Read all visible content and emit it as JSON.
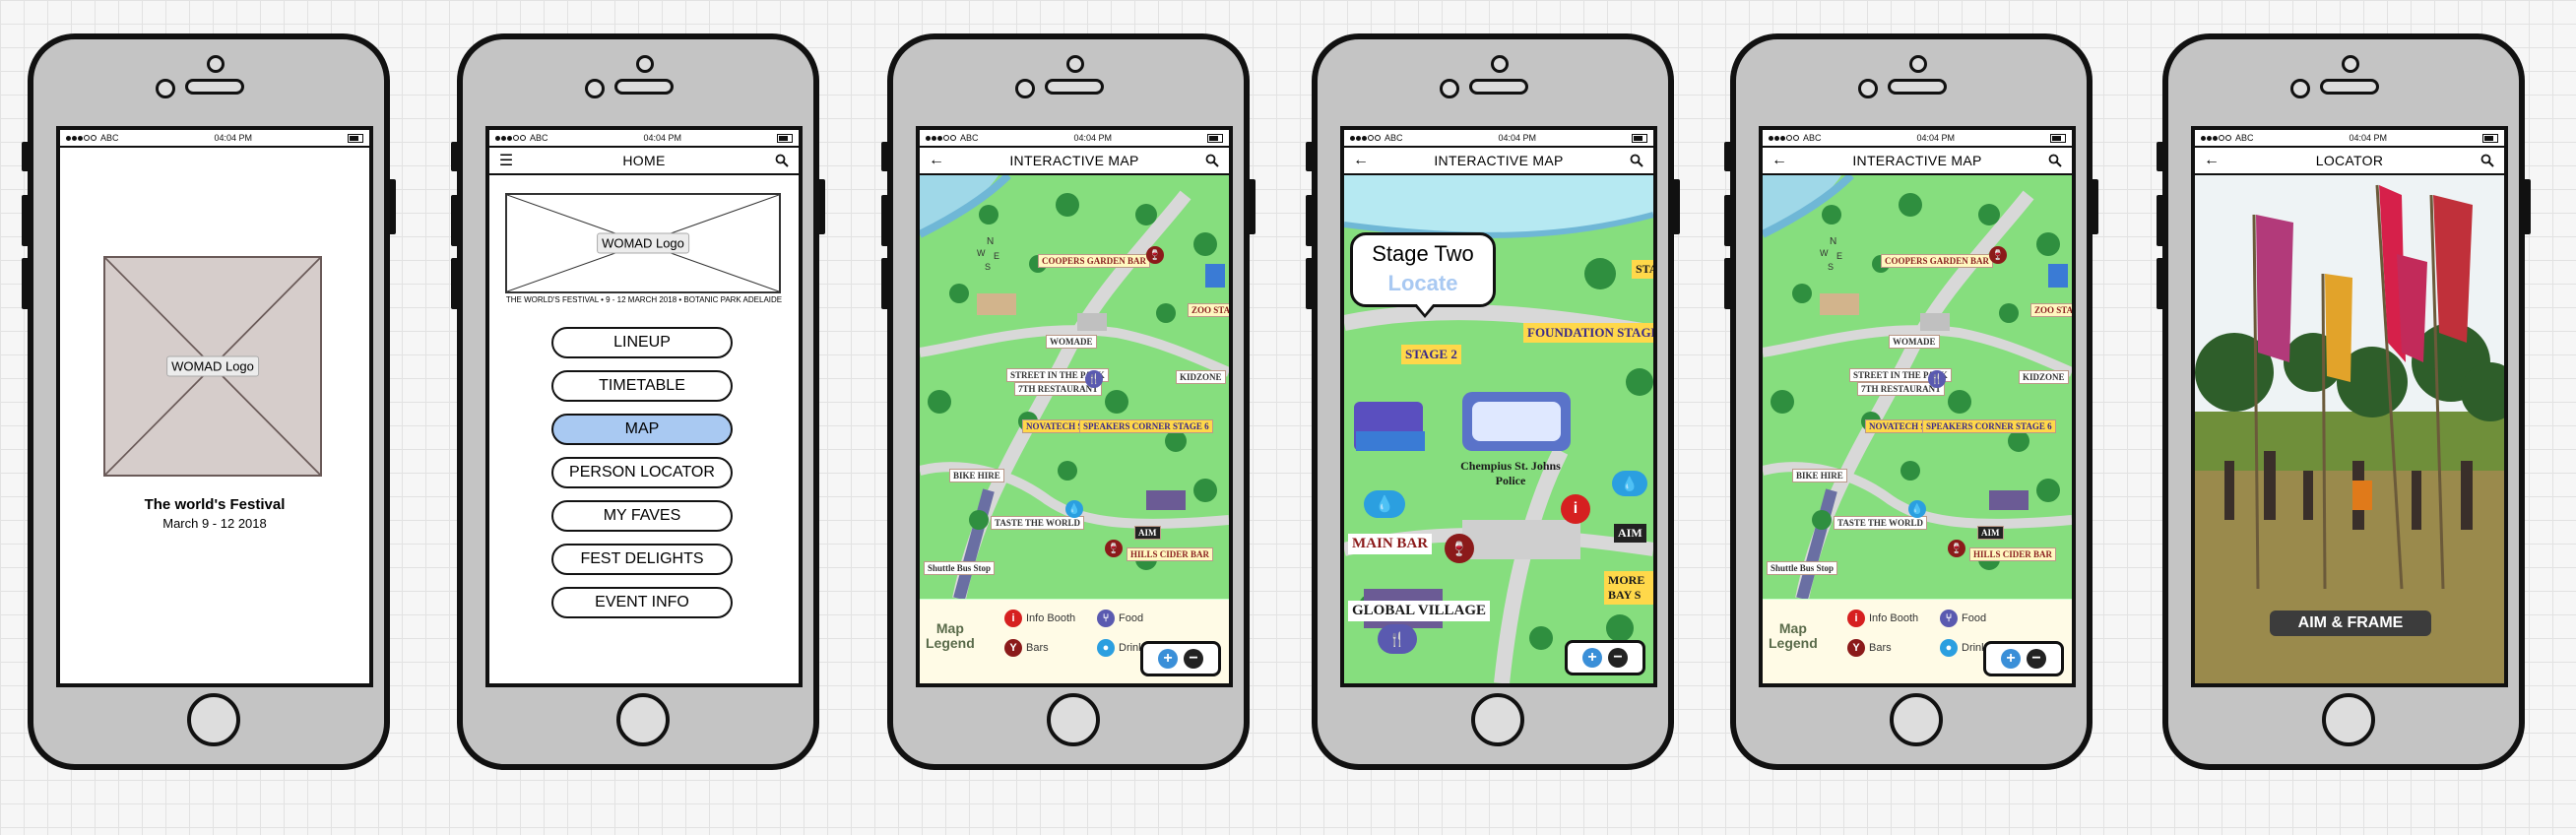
{
  "status": {
    "carrier": "ABC",
    "time": "04:04 PM"
  },
  "screens": {
    "splash": {
      "logo_label": "WOMAD Logo",
      "title": "The world's Festival",
      "dates": "March 9 - 12 2018"
    },
    "home": {
      "header_title": "HOME",
      "logo_label": "WOMAD Logo",
      "tagline": "THE WORLD'S FESTIVAL • 9 - 12 MARCH 2018 • BOTANIC PARK ADELAIDE",
      "menu": [
        {
          "label": "LINEUP",
          "active": false
        },
        {
          "label": "TIMETABLE",
          "active": false
        },
        {
          "label": "MAP",
          "active": true
        },
        {
          "label": "PERSON LOCATOR",
          "active": false
        },
        {
          "label": "MY FAVES",
          "active": false
        },
        {
          "label": "FEST DELIGHTS",
          "active": false
        },
        {
          "label": "EVENT INFO",
          "active": false
        }
      ]
    },
    "map": {
      "header_title": "INTERACTIVE MAP",
      "map_labels": [
        "COOPERS GARDEN BAR",
        "ZOO STAGE",
        "WOMADE",
        "STREET IN THE PARK",
        "7TH RESTAURANT",
        "KIDZONE",
        "NOVATECH STAGE",
        "SPEAKERS CORNER STAGE 6",
        "BIKE HIRE",
        "TASTE THE WORLD",
        "AIM",
        "HILLS CIDER BAR",
        "Shuttle Bus Stop"
      ],
      "legend": {
        "title_line1": "Map",
        "title_line2": "Legend",
        "items": [
          {
            "label": "Info Booth",
            "icon": "info-icon"
          },
          {
            "label": "Food",
            "icon": "food-icon"
          },
          {
            "label": "Bars",
            "icon": "bar-icon"
          },
          {
            "label": "Drink",
            "icon": "water-icon"
          }
        ]
      }
    },
    "map_zoom": {
      "header_title": "INTERACTIVE MAP",
      "bubble_title": "Stage Two",
      "bubble_action": "Locate",
      "labels": [
        "STAGE 2",
        "FOUNDATION STAGE",
        "Chempius St. Johns Police",
        "MAIN BAR",
        "GLOBAL VILLAGE",
        "AIM",
        "MORE BAY S",
        "STA"
      ]
    },
    "locator": {
      "header_title": "LOCATOR",
      "badge": "AIM & FRAME"
    }
  },
  "colors": {
    "active_button": "#a9c9f2",
    "map_green": "#7fdc80",
    "zoom_plus": "#3a8fd8"
  }
}
